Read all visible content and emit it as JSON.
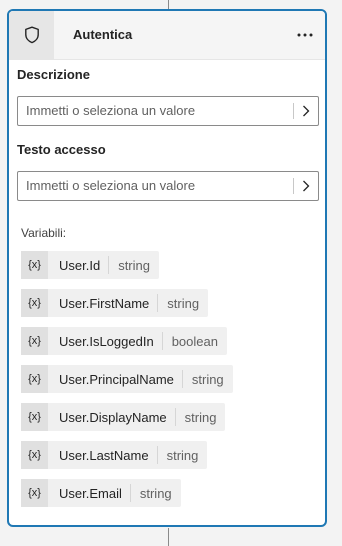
{
  "card": {
    "title": "Autentica",
    "header_icon": "shield-icon",
    "more_icon": "more-horizontal-icon"
  },
  "fields": [
    {
      "label": "Descrizione",
      "placeholder": "Immetti o seleziona un valore"
    },
    {
      "label": "Testo accesso",
      "placeholder": "Immetti o seleziona un valore"
    }
  ],
  "variables": {
    "label": "Variabili:",
    "icon_text": "{x}",
    "items": [
      {
        "name": "User.Id",
        "type": "string"
      },
      {
        "name": "User.FirstName",
        "type": "string"
      },
      {
        "name": "User.IsLoggedIn",
        "type": "boolean"
      },
      {
        "name": "User.PrincipalName",
        "type": "string"
      },
      {
        "name": "User.DisplayName",
        "type": "string"
      },
      {
        "name": "User.LastName",
        "type": "string"
      },
      {
        "name": "User.Email",
        "type": "string"
      }
    ]
  },
  "colors": {
    "accent_border": "#1f78b4",
    "header_bg": "#f5f5f5",
    "chip_bg": "#f0f0f0"
  }
}
